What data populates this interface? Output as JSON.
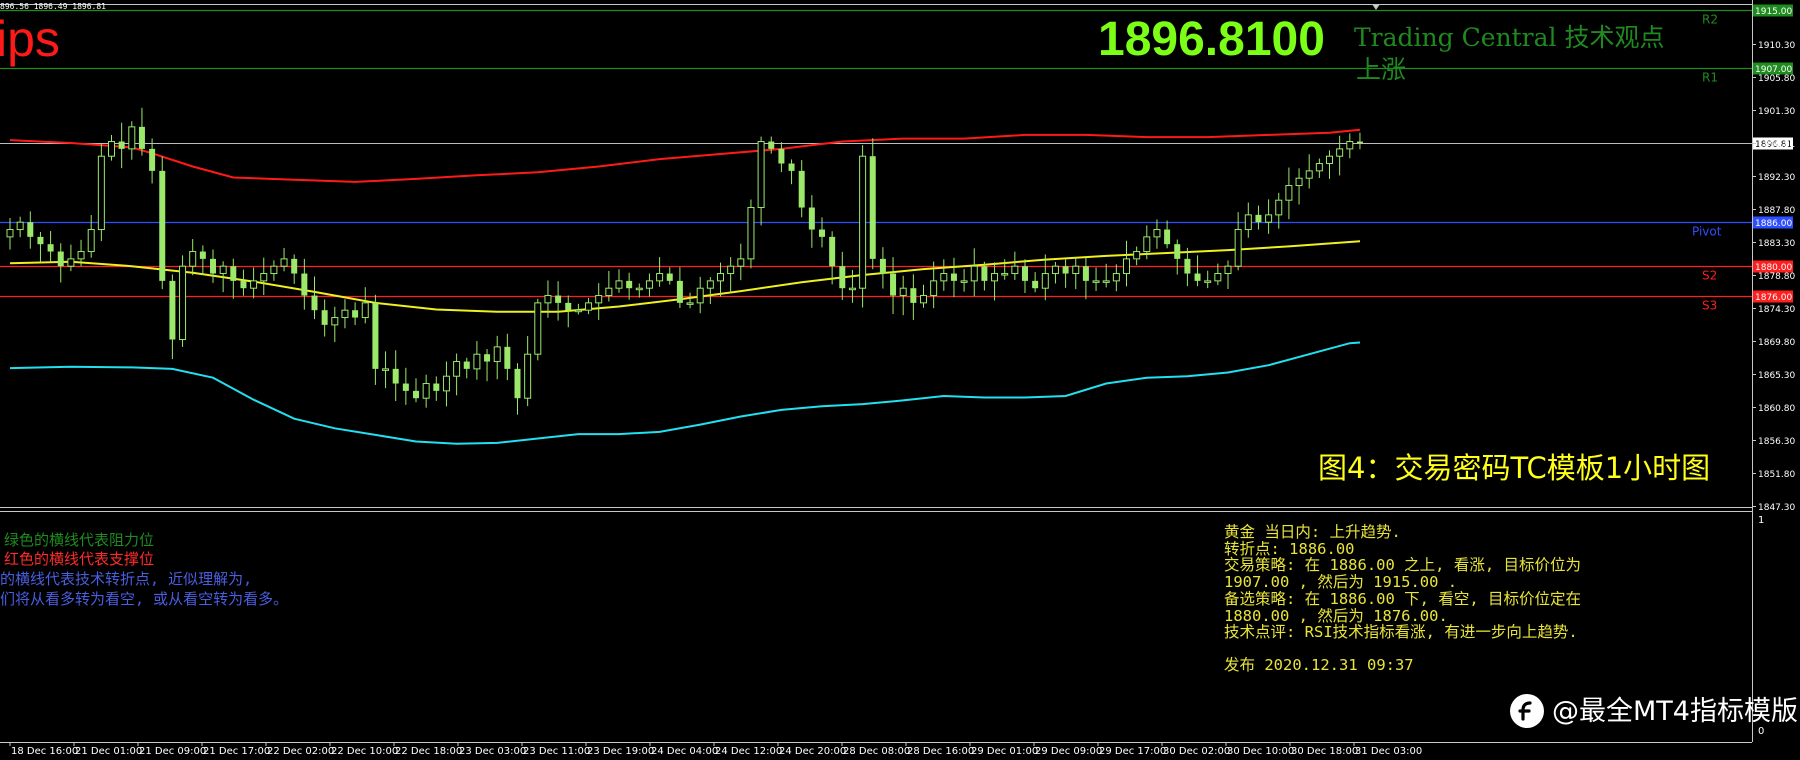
{
  "header": {
    "ohlc_text": "896.56 1896.49 1896.81",
    "brand_fragment": "ips",
    "current_price": "1896.8100",
    "provider_title": "Trading Central 技术观点",
    "trend": "上涨"
  },
  "caption": "图4：交易密码TC模板1小时图",
  "legend": [
    {
      "text": "绿色的横线代表阻力位",
      "color": "#1e8c1e"
    },
    {
      "text": "红色的横线代表支撑位",
      "color": "#ff2a2a"
    },
    {
      "text": "的横线代表技术转折点, 近似理解为,",
      "color": "#4a5ee0"
    },
    {
      "text": "们将从看多转为看空,  或从看空转为看多。",
      "color": "#4a5ee0"
    }
  ],
  "analysis": {
    "lines": [
      "黄金 当日内: 上升趋势.",
      "转折点: 1886.00",
      "交易策略: 在 1886.00 之上, 看涨, 目标价位为",
      "1907.00 , 然后为 1915.00 .",
      "备选策略: 在 1886.00 下, 看空, 目标价位定在",
      "1880.00 , 然后为 1876.00.",
      "技术点评: RSI技术指标看涨, 有进一步向上趋势."
    ],
    "published": "发布 2020.12.31 09:37"
  },
  "watermark": "@最全MT4指标模版",
  "subwindow_scale": {
    "top": "1",
    "bottom": "0"
  },
  "colors": {
    "resistance": "#1e8c1e",
    "support": "#ff1f1f",
    "pivot": "#2e4fff",
    "upper_band": "#ff1a1a",
    "lower_band": "#22e0f0",
    "moving_average": "#f0f020",
    "candles": "#9be86a",
    "current_price_line": "#bdbdbd"
  },
  "chart_data": {
    "type": "candlestick",
    "symbol": "XAUUSD",
    "timeframe": "H1",
    "ylim": [
      1845,
      1916
    ],
    "y_ticks": [
      "1910.30",
      "1905.80",
      "1901.30",
      "1896.81",
      "1892.30",
      "1887.80",
      "1883.30",
      "1878.80",
      "1874.30",
      "1869.80",
      "1865.30",
      "1860.80",
      "1856.30",
      "1851.80",
      "1847.30"
    ],
    "x_ticks": [
      "18 Dec 16:00",
      "21 Dec 01:00",
      "21 Dec 09:00",
      "21 Dec 17:00",
      "22 Dec 02:00",
      "22 Dec 10:00",
      "22 Dec 18:00",
      "23 Dec 03:00",
      "23 Dec 11:00",
      "23 Dec 19:00",
      "24 Dec 04:00",
      "24 Dec 12:00",
      "24 Dec 20:00",
      "28 Dec 08:00",
      "28 Dec 16:00",
      "29 Dec 01:00",
      "29 Dec 09:00",
      "29 Dec 17:00",
      "30 Dec 02:00",
      "30 Dec 10:00",
      "30 Dec 18:00",
      "31 Dec 03:00"
    ],
    "levels": [
      {
        "name": "R2",
        "value": 1915.0,
        "tag": "1915.00",
        "kind": "resistance"
      },
      {
        "name": "R1",
        "value": 1907.0,
        "tag": "1907.00",
        "kind": "resistance"
      },
      {
        "name": "Pivot",
        "value": 1886.0,
        "tag": "1886.00",
        "kind": "pivot"
      },
      {
        "name": "S2",
        "value": 1880.0,
        "tag": "1880.00",
        "kind": "support"
      },
      {
        "name": "S3",
        "value": 1876.0,
        "tag": "1876.00",
        "kind": "support"
      }
    ],
    "current_price": 1896.81,
    "upper_band": [
      [
        0,
        1897.2
      ],
      [
        6,
        1896.8
      ],
      [
        12,
        1896.2
      ],
      [
        14,
        1895.4
      ],
      [
        18,
        1893.6
      ],
      [
        22,
        1892.1
      ],
      [
        28,
        1891.8
      ],
      [
        34,
        1891.5
      ],
      [
        40,
        1891.9
      ],
      [
        46,
        1892.4
      ],
      [
        52,
        1892.8
      ],
      [
        58,
        1893.6
      ],
      [
        64,
        1894.6
      ],
      [
        70,
        1895.3
      ],
      [
        76,
        1896.0
      ],
      [
        82,
        1897.0
      ],
      [
        88,
        1897.4
      ],
      [
        94,
        1897.4
      ],
      [
        100,
        1897.9
      ],
      [
        106,
        1897.9
      ],
      [
        112,
        1897.6
      ],
      [
        118,
        1897.6
      ],
      [
        124,
        1897.9
      ],
      [
        130,
        1898.2
      ],
      [
        133,
        1898.6
      ]
    ],
    "moving_average": [
      [
        0,
        1880.4
      ],
      [
        6,
        1880.6
      ],
      [
        12,
        1880.0
      ],
      [
        18,
        1879.1
      ],
      [
        24,
        1877.9
      ],
      [
        30,
        1876.5
      ],
      [
        36,
        1875.0
      ],
      [
        42,
        1874.1
      ],
      [
        48,
        1873.8
      ],
      [
        54,
        1873.8
      ],
      [
        60,
        1874.5
      ],
      [
        66,
        1875.5
      ],
      [
        72,
        1876.6
      ],
      [
        78,
        1877.8
      ],
      [
        84,
        1878.8
      ],
      [
        90,
        1879.6
      ],
      [
        96,
        1880.2
      ],
      [
        102,
        1880.9
      ],
      [
        108,
        1881.4
      ],
      [
        114,
        1881.8
      ],
      [
        120,
        1882.2
      ],
      [
        126,
        1882.7
      ],
      [
        133,
        1883.4
      ]
    ],
    "lower_band": [
      [
        0,
        1866.1
      ],
      [
        6,
        1866.3
      ],
      [
        12,
        1866.2
      ],
      [
        16,
        1866.0
      ],
      [
        20,
        1864.8
      ],
      [
        24,
        1861.8
      ],
      [
        28,
        1859.2
      ],
      [
        32,
        1857.9
      ],
      [
        36,
        1857.0
      ],
      [
        40,
        1856.1
      ],
      [
        44,
        1855.8
      ],
      [
        48,
        1855.9
      ],
      [
        52,
        1856.5
      ],
      [
        56,
        1857.1
      ],
      [
        60,
        1857.1
      ],
      [
        64,
        1857.4
      ],
      [
        68,
        1858.4
      ],
      [
        72,
        1859.5
      ],
      [
        76,
        1860.4
      ],
      [
        80,
        1860.9
      ],
      [
        84,
        1861.2
      ],
      [
        88,
        1861.7
      ],
      [
        92,
        1862.3
      ],
      [
        96,
        1862.1
      ],
      [
        100,
        1862.1
      ],
      [
        104,
        1862.3
      ],
      [
        108,
        1864.0
      ],
      [
        112,
        1864.8
      ],
      [
        116,
        1865.0
      ],
      [
        120,
        1865.5
      ],
      [
        124,
        1866.5
      ],
      [
        128,
        1868.0
      ],
      [
        132,
        1869.5
      ],
      [
        133,
        1869.6
      ]
    ],
    "closes": [
      1885,
      1886,
      1884,
      1883,
      1882,
      1880,
      1881,
      1882,
      1885,
      1895,
      1897,
      1896,
      1899,
      1896,
      1893,
      1878,
      1870,
      1880,
      1882,
      1881,
      1879,
      1880,
      1878,
      1877,
      1878,
      1879,
      1880,
      1881,
      1879,
      1876,
      1874,
      1872,
      1873,
      1874,
      1873,
      1875,
      1866,
      1866,
      1864,
      1863,
      1862,
      1864,
      1863,
      1865,
      1867,
      1866,
      1868,
      1867,
      1869,
      1866,
      1862,
      1868,
      1875,
      1876,
      1875,
      1874,
      1874,
      1875,
      1876,
      1877,
      1878,
      1877,
      1877,
      1878,
      1879,
      1878,
      1875,
      1875,
      1877,
      1878,
      1879,
      1880,
      1881,
      1888,
      1897,
      1896,
      1894,
      1893,
      1888,
      1885,
      1884,
      1880,
      1877,
      1877,
      1895,
      1881,
      1879,
      1876,
      1877,
      1875,
      1876,
      1878,
      1879,
      1878,
      1878,
      1880,
      1878,
      1879,
      1879,
      1880,
      1878,
      1877,
      1879,
      1880,
      1879,
      1880,
      1878,
      1878,
      1878,
      1879,
      1881,
      1882,
      1884,
      1885,
      1883,
      1881,
      1879,
      1878,
      1878,
      1879,
      1880,
      1885,
      1887,
      1886,
      1887,
      1889,
      1891,
      1892,
      1893,
      1894,
      1895,
      1896,
      1897,
      1896.8
    ]
  }
}
